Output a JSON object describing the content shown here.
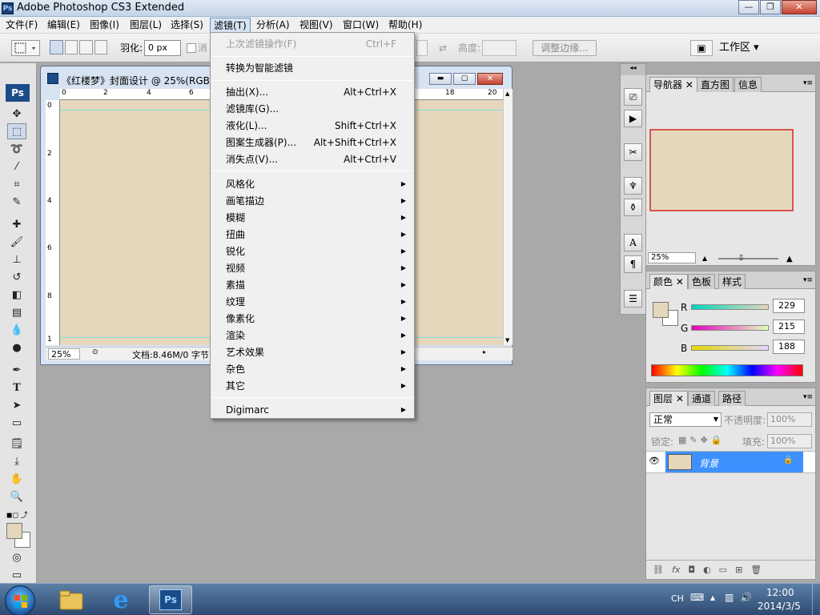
{
  "app": {
    "title": "Adobe Photoshop CS3 Extended",
    "icon_label": "Ps"
  },
  "window_buttons": {
    "minimize": "—",
    "maximize": "❐",
    "close": "✕"
  },
  "menubar": {
    "items": [
      {
        "label": "文件(F)"
      },
      {
        "label": "编辑(E)"
      },
      {
        "label": "图像(I)"
      },
      {
        "label": "图层(L)"
      },
      {
        "label": "选择(S)"
      },
      {
        "label": "滤镜(T)"
      },
      {
        "label": "分析(A)"
      },
      {
        "label": "视图(V)"
      },
      {
        "label": "窗口(W)"
      },
      {
        "label": "帮助(H)"
      }
    ],
    "active": "滤镜(T)"
  },
  "options_bar": {
    "feather_label": "羽化:",
    "feather_value": "0 px",
    "antialias_label": "消",
    "height_label": "高度:",
    "refine_edge_button": "调整边缘...",
    "workspace_label": "工作区 ▾"
  },
  "document": {
    "title": "《红楼梦》封面设计 @ 25%(RGB",
    "zoom": "25%",
    "doc_info": "文档:8.46M/0 字节",
    "ruler_h": [
      "0",
      "2",
      "4",
      "6",
      "18",
      "20"
    ],
    "ruler_v": [
      "0",
      "2",
      "4",
      "6",
      "8",
      "1"
    ],
    "canvas_color": "#e5d7bc"
  },
  "filter_menu": {
    "group1": [
      {
        "label": "上次滤镜操作(F)",
        "shortcut": "Ctrl+F",
        "disabled": true
      }
    ],
    "group2": [
      {
        "label": "转换为智能滤镜"
      }
    ],
    "group3": [
      {
        "label": "抽出(X)...",
        "shortcut": "Alt+Ctrl+X"
      },
      {
        "label": "滤镜库(G)...",
        "shortcut": ""
      },
      {
        "label": "液化(L)...",
        "shortcut": "Shift+Ctrl+X"
      },
      {
        "label": "图案生成器(P)...",
        "shortcut": "Alt+Shift+Ctrl+X"
      },
      {
        "label": "消失点(V)...",
        "shortcut": "Alt+Ctrl+V"
      }
    ],
    "group4": [
      {
        "label": "风格化"
      },
      {
        "label": "画笔描边"
      },
      {
        "label": "模糊"
      },
      {
        "label": "扭曲"
      },
      {
        "label": "锐化"
      },
      {
        "label": "视频"
      },
      {
        "label": "素描"
      },
      {
        "label": "纹理"
      },
      {
        "label": "像素化"
      },
      {
        "label": "渲染"
      },
      {
        "label": "艺术效果"
      },
      {
        "label": "杂色"
      },
      {
        "label": "其它"
      }
    ],
    "group5": [
      {
        "label": "Digimarc"
      }
    ]
  },
  "navigator_panel": {
    "tabs": [
      "导航器",
      "直方图",
      "信息"
    ],
    "zoom": "25%",
    "proxy_color": "#e5d7bc",
    "proxy_frame_color": "#d9534f"
  },
  "color_panel": {
    "tabs": [
      "颜色",
      "色板",
      "样式"
    ],
    "channels": [
      {
        "label": "R",
        "value": "229"
      },
      {
        "label": "G",
        "value": "215"
      },
      {
        "label": "B",
        "value": "188"
      }
    ],
    "foreground": "#e5d7bc",
    "background": "#ffffff"
  },
  "layers_panel": {
    "tabs": [
      "图层",
      "通道",
      "路径"
    ],
    "blend_mode": "正常",
    "opacity_label": "不透明度:",
    "opacity": "100%",
    "lock_label": "锁定:",
    "fill_label": "填充:",
    "fill": "100%",
    "layers": [
      {
        "name": "背景",
        "selected": true,
        "locked": true,
        "thumb_color": "#e5d7bc"
      }
    ]
  },
  "taskbar": {
    "lang": "CH",
    "time": "12:00",
    "date": "2014/3/5",
    "apps": [
      "explorer",
      "internet-explorer",
      "photoshop"
    ],
    "ps_label": "Ps"
  }
}
